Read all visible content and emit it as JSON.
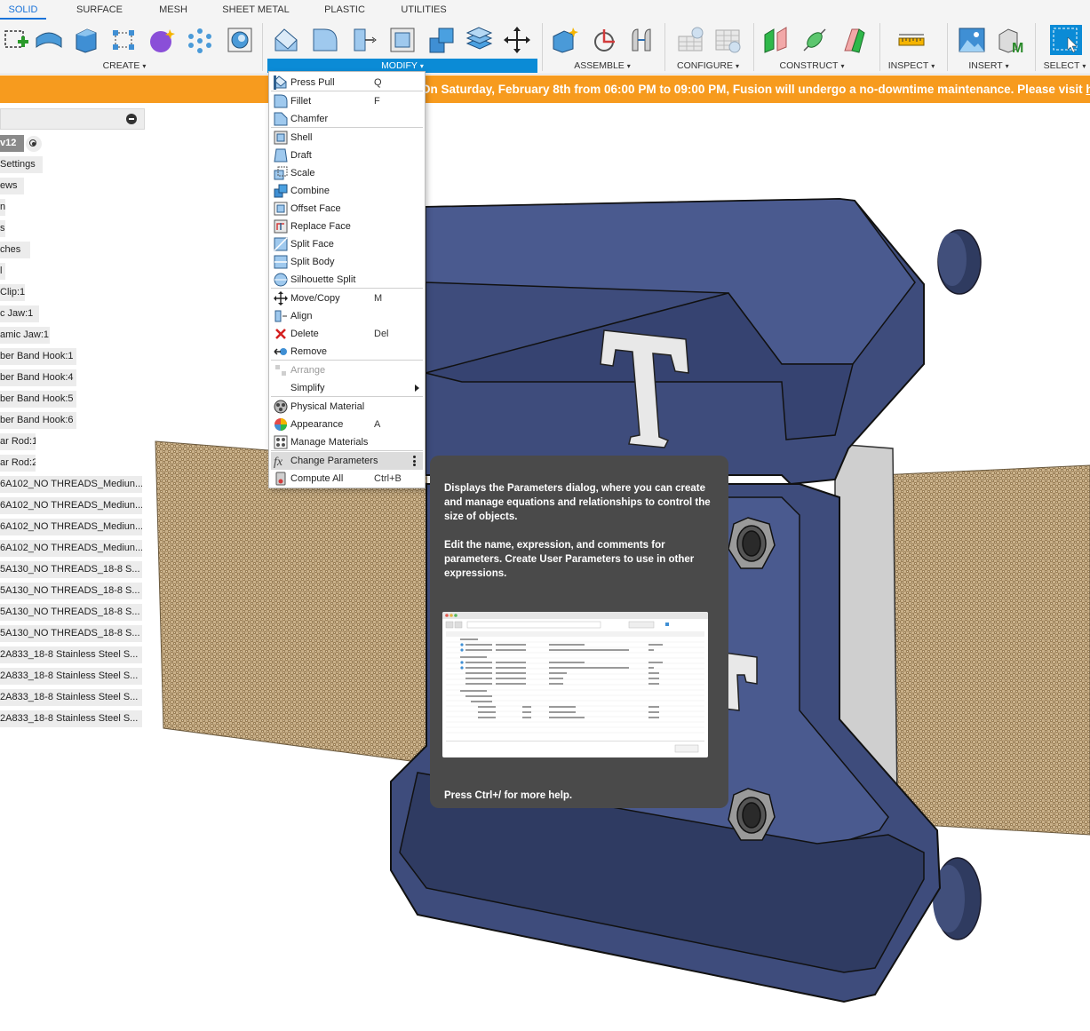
{
  "tabs": [
    {
      "label": "SOLID",
      "active": true
    },
    {
      "label": "SURFACE"
    },
    {
      "label": "MESH"
    },
    {
      "label": "SHEET METAL"
    },
    {
      "label": "PLASTIC"
    },
    {
      "label": "UTILITIES"
    }
  ],
  "toolbar": {
    "groups": {
      "create": "CREATE",
      "modify": "MODIFY",
      "assemble": "ASSEMBLE",
      "configure": "CONFIGURE",
      "construct": "CONSTRUCT",
      "inspect": "INSPECT",
      "insert": "INSERT",
      "select": "SELECT"
    },
    "caret": "▾"
  },
  "banner": {
    "text": "On Saturday, February 8th from 06:00 PM to 09:00 PM, Fusion will undergo a no-downtime maintenance. Please visit ",
    "link": "he"
  },
  "browser": {
    "items": [
      "v12",
      "Settings",
      "ews",
      "n",
      "s",
      "ches",
      "l",
      "Clip:1",
      "c Jaw:1",
      "amic Jaw:1",
      "ber Band Hook:1",
      "ber Band Hook:4",
      "ber Band Hook:5",
      "ber Band Hook:6",
      "ar Rod:1",
      "ar Rod:2",
      "6A102_NO THREADS_Mediun...",
      "6A102_NO THREADS_Mediun...",
      "6A102_NO THREADS_Mediun...",
      "6A102_NO THREADS_Mediun...",
      "5A130_NO THREADS_18-8 S...",
      "5A130_NO THREADS_18-8 S...",
      "5A130_NO THREADS_18-8 S...",
      "5A130_NO THREADS_18-8 S...",
      "2A833_18-8 Stainless Steel S...",
      "2A833_18-8 Stainless Steel S...",
      "2A833_18-8 Stainless Steel S...",
      "2A833_18-8 Stainless Steel S..."
    ]
  },
  "menu": {
    "items": [
      {
        "label": "Press Pull",
        "shortcut": "Q",
        "icon": "press-pull-icon"
      },
      {
        "label": "Fillet",
        "shortcut": "F",
        "icon": "fillet-icon"
      },
      {
        "label": "Chamfer",
        "shortcut": "",
        "icon": "chamfer-icon"
      },
      {
        "label": "Shell",
        "shortcut": "",
        "icon": "shell-icon"
      },
      {
        "label": "Draft",
        "shortcut": "",
        "icon": "draft-icon"
      },
      {
        "label": "Scale",
        "shortcut": "",
        "icon": "scale-icon"
      },
      {
        "label": "Combine",
        "shortcut": "",
        "icon": "combine-icon"
      },
      {
        "label": "Offset Face",
        "shortcut": "",
        "icon": "offset-face-icon"
      },
      {
        "label": "Replace Face",
        "shortcut": "",
        "icon": "replace-face-icon"
      },
      {
        "label": "Split Face",
        "shortcut": "",
        "icon": "split-face-icon"
      },
      {
        "label": "Split Body",
        "shortcut": "",
        "icon": "split-body-icon"
      },
      {
        "label": "Silhouette Split",
        "shortcut": "",
        "icon": "silhouette-split-icon"
      },
      {
        "label": "Move/Copy",
        "shortcut": "M",
        "icon": "move-icon"
      },
      {
        "label": "Align",
        "shortcut": "",
        "icon": "align-icon"
      },
      {
        "label": "Delete",
        "shortcut": "Del",
        "icon": "delete-icon"
      },
      {
        "label": "Remove",
        "shortcut": "",
        "icon": "remove-icon"
      },
      {
        "label": "Arrange",
        "shortcut": "",
        "icon": "arrange-icon",
        "disabled": true
      },
      {
        "label": "Simplify",
        "shortcut": "",
        "icon": "",
        "submenu": true
      },
      {
        "label": "Physical Material",
        "shortcut": "",
        "icon": "physical-material-icon"
      },
      {
        "label": "Appearance",
        "shortcut": "A",
        "icon": "appearance-icon"
      },
      {
        "label": "Manage Materials",
        "shortcut": "",
        "icon": "manage-materials-icon"
      },
      {
        "label": "Change Parameters",
        "shortcut": "",
        "icon": "fx-icon",
        "hover": true
      },
      {
        "label": "Compute All",
        "shortcut": "Ctrl+B",
        "icon": "compute-all-icon"
      }
    ]
  },
  "tooltip": {
    "p1": "Displays the Parameters dialog, where you can create and manage equations and relationships to control the size of objects.",
    "p2": "Edit the name, expression, and comments for parameters. Create User Parameters to use in other expressions.",
    "help": "Press Ctrl+/ for more help."
  },
  "colors": {
    "accent": "#0b8bd6",
    "banner": "#f79b1e",
    "model_blue": "#3f4f7e",
    "tooltip_bg": "#4a4a4a"
  }
}
